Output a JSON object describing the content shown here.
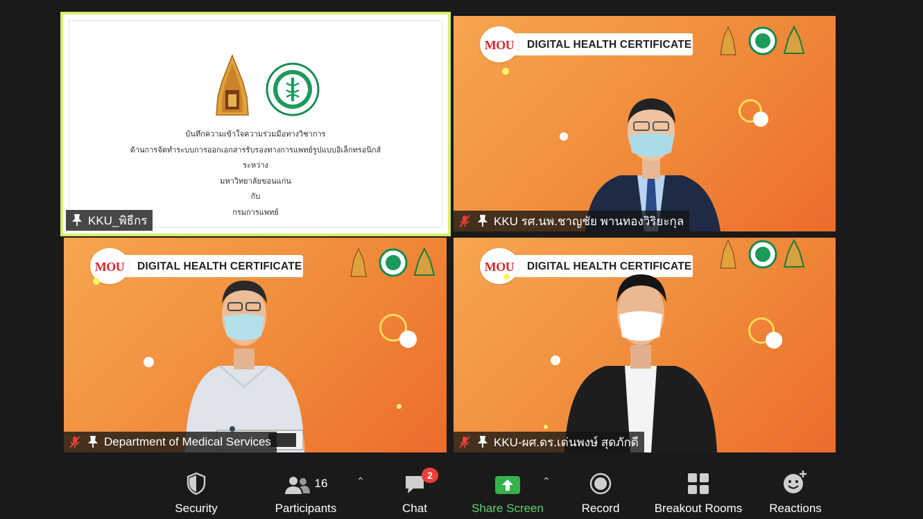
{
  "tiles": [
    {
      "name": "KKU_พิธีกร",
      "type": "slide",
      "slide_lines": [
        "บันทึกความเข้าใจความร่วมมือทางวิชาการ",
        "ด้านการจัดทำระบบการออกเอกสารรับรองทางการแพทย์รูปแบบอิเล็กทรอนิกส์",
        "ระหว่าง",
        "มหาวิทยาลัยขอนแก่น",
        "กับ",
        "กรมการแพทย์"
      ]
    },
    {
      "name": "KKU รศ.นพ.ชาญชัย พานทองวิริยะกุล",
      "muted": true
    },
    {
      "name": "Department of Medical Services",
      "muted": true
    },
    {
      "name": "KKU-ผศ.ดร.เด่นพงษ์ สุดภักดี",
      "muted": true
    }
  ],
  "banner": {
    "mou": "MOU",
    "title": "DIGITAL HEALTH CERTIFICATE"
  },
  "toolbar": {
    "security": "Security",
    "participants": "Participants",
    "participants_count": "16",
    "chat": "Chat",
    "chat_badge": "2",
    "share_screen": "Share Screen",
    "record": "Record",
    "breakout_rooms": "Breakout Rooms",
    "reactions": "Reactions"
  },
  "colors": {
    "active_speaker_border": "#d9ef6a",
    "share_green": "#5fd36b",
    "badge_red": "#e8403a"
  }
}
